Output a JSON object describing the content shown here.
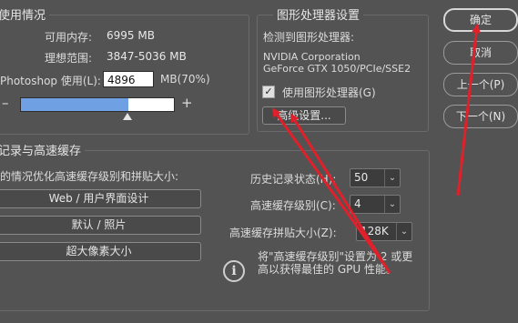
{
  "memory": {
    "title": "使用情况",
    "available_label": "可用内存:",
    "available_value": "6995 MB",
    "ideal_label": "理想范围:",
    "ideal_value": "3847-5036 MB",
    "usage_label": "Photoshop 使用(L):",
    "usage_value": "4896",
    "usage_unit": "MB(70%)",
    "slider_percent": 70,
    "minus": "–",
    "plus": "+"
  },
  "gpu": {
    "title": "图形处理器设置",
    "detected_label": "检测到图形处理器:",
    "vendor": "NVIDIA Corporation",
    "model": "GeForce GTX 1050/PCIe/SSE2",
    "use_gpu_label": "使用图形处理器(G)",
    "use_gpu_checked": true,
    "advanced_button": "高级设置..."
  },
  "history_cache": {
    "title": "记录与高速缓存",
    "optimize_label": "的情况优化高速缓存级别和拼贴大小:",
    "preset_web": "Web / 用户界面设计",
    "preset_default": "默认 / 照片",
    "preset_huge": "超大像素大小",
    "history_states_label": "历史记录状态(H):",
    "history_states_value": "50",
    "cache_levels_label": "高速缓存级别(C):",
    "cache_levels_value": "4",
    "tile_size_label": "高速缓存拼贴大小(Z):",
    "tile_size_value": "128K",
    "note_line1": "将\"高速缓存级别\"设置为 2 或更",
    "note_line2": "高以获得最佳的 GPU 性能。"
  },
  "buttons": {
    "ok": "确定",
    "cancel": "取消",
    "prev": "上一个(P)",
    "next": "下一个(N)"
  },
  "colors": {
    "annotation_arrow": "#e0202a",
    "slider_fill": "#6fa0e4",
    "background": "#535353"
  }
}
